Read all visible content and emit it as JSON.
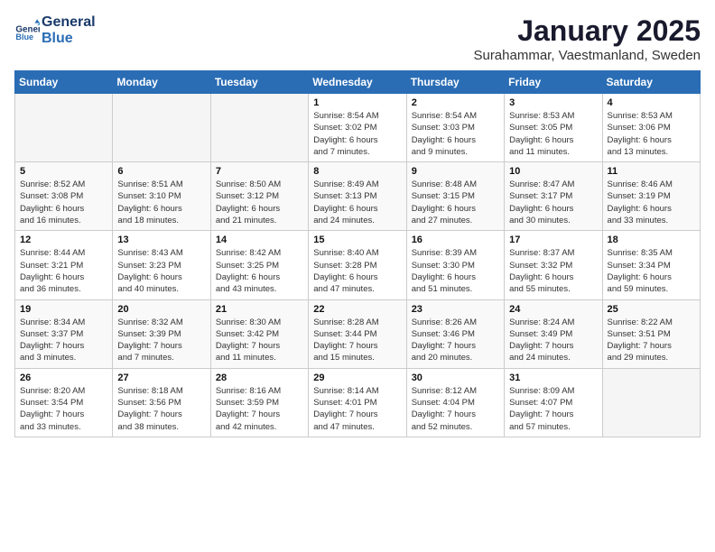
{
  "header": {
    "logo_line1": "General",
    "logo_line2": "Blue",
    "month": "January 2025",
    "location": "Surahammar, Vaestmanland, Sweden"
  },
  "weekdays": [
    "Sunday",
    "Monday",
    "Tuesday",
    "Wednesday",
    "Thursday",
    "Friday",
    "Saturday"
  ],
  "weeks": [
    [
      {
        "day": "",
        "info": ""
      },
      {
        "day": "",
        "info": ""
      },
      {
        "day": "",
        "info": ""
      },
      {
        "day": "1",
        "info": "Sunrise: 8:54 AM\nSunset: 3:02 PM\nDaylight: 6 hours\nand 7 minutes."
      },
      {
        "day": "2",
        "info": "Sunrise: 8:54 AM\nSunset: 3:03 PM\nDaylight: 6 hours\nand 9 minutes."
      },
      {
        "day": "3",
        "info": "Sunrise: 8:53 AM\nSunset: 3:05 PM\nDaylight: 6 hours\nand 11 minutes."
      },
      {
        "day": "4",
        "info": "Sunrise: 8:53 AM\nSunset: 3:06 PM\nDaylight: 6 hours\nand 13 minutes."
      }
    ],
    [
      {
        "day": "5",
        "info": "Sunrise: 8:52 AM\nSunset: 3:08 PM\nDaylight: 6 hours\nand 16 minutes."
      },
      {
        "day": "6",
        "info": "Sunrise: 8:51 AM\nSunset: 3:10 PM\nDaylight: 6 hours\nand 18 minutes."
      },
      {
        "day": "7",
        "info": "Sunrise: 8:50 AM\nSunset: 3:12 PM\nDaylight: 6 hours\nand 21 minutes."
      },
      {
        "day": "8",
        "info": "Sunrise: 8:49 AM\nSunset: 3:13 PM\nDaylight: 6 hours\nand 24 minutes."
      },
      {
        "day": "9",
        "info": "Sunrise: 8:48 AM\nSunset: 3:15 PM\nDaylight: 6 hours\nand 27 minutes."
      },
      {
        "day": "10",
        "info": "Sunrise: 8:47 AM\nSunset: 3:17 PM\nDaylight: 6 hours\nand 30 minutes."
      },
      {
        "day": "11",
        "info": "Sunrise: 8:46 AM\nSunset: 3:19 PM\nDaylight: 6 hours\nand 33 minutes."
      }
    ],
    [
      {
        "day": "12",
        "info": "Sunrise: 8:44 AM\nSunset: 3:21 PM\nDaylight: 6 hours\nand 36 minutes."
      },
      {
        "day": "13",
        "info": "Sunrise: 8:43 AM\nSunset: 3:23 PM\nDaylight: 6 hours\nand 40 minutes."
      },
      {
        "day": "14",
        "info": "Sunrise: 8:42 AM\nSunset: 3:25 PM\nDaylight: 6 hours\nand 43 minutes."
      },
      {
        "day": "15",
        "info": "Sunrise: 8:40 AM\nSunset: 3:28 PM\nDaylight: 6 hours\nand 47 minutes."
      },
      {
        "day": "16",
        "info": "Sunrise: 8:39 AM\nSunset: 3:30 PM\nDaylight: 6 hours\nand 51 minutes."
      },
      {
        "day": "17",
        "info": "Sunrise: 8:37 AM\nSunset: 3:32 PM\nDaylight: 6 hours\nand 55 minutes."
      },
      {
        "day": "18",
        "info": "Sunrise: 8:35 AM\nSunset: 3:34 PM\nDaylight: 6 hours\nand 59 minutes."
      }
    ],
    [
      {
        "day": "19",
        "info": "Sunrise: 8:34 AM\nSunset: 3:37 PM\nDaylight: 7 hours\nand 3 minutes."
      },
      {
        "day": "20",
        "info": "Sunrise: 8:32 AM\nSunset: 3:39 PM\nDaylight: 7 hours\nand 7 minutes."
      },
      {
        "day": "21",
        "info": "Sunrise: 8:30 AM\nSunset: 3:42 PM\nDaylight: 7 hours\nand 11 minutes."
      },
      {
        "day": "22",
        "info": "Sunrise: 8:28 AM\nSunset: 3:44 PM\nDaylight: 7 hours\nand 15 minutes."
      },
      {
        "day": "23",
        "info": "Sunrise: 8:26 AM\nSunset: 3:46 PM\nDaylight: 7 hours\nand 20 minutes."
      },
      {
        "day": "24",
        "info": "Sunrise: 8:24 AM\nSunset: 3:49 PM\nDaylight: 7 hours\nand 24 minutes."
      },
      {
        "day": "25",
        "info": "Sunrise: 8:22 AM\nSunset: 3:51 PM\nDaylight: 7 hours\nand 29 minutes."
      }
    ],
    [
      {
        "day": "26",
        "info": "Sunrise: 8:20 AM\nSunset: 3:54 PM\nDaylight: 7 hours\nand 33 minutes."
      },
      {
        "day": "27",
        "info": "Sunrise: 8:18 AM\nSunset: 3:56 PM\nDaylight: 7 hours\nand 38 minutes."
      },
      {
        "day": "28",
        "info": "Sunrise: 8:16 AM\nSunset: 3:59 PM\nDaylight: 7 hours\nand 42 minutes."
      },
      {
        "day": "29",
        "info": "Sunrise: 8:14 AM\nSunset: 4:01 PM\nDaylight: 7 hours\nand 47 minutes."
      },
      {
        "day": "30",
        "info": "Sunrise: 8:12 AM\nSunset: 4:04 PM\nDaylight: 7 hours\nand 52 minutes."
      },
      {
        "day": "31",
        "info": "Sunrise: 8:09 AM\nSunset: 4:07 PM\nDaylight: 7 hours\nand 57 minutes."
      },
      {
        "day": "",
        "info": ""
      }
    ]
  ]
}
